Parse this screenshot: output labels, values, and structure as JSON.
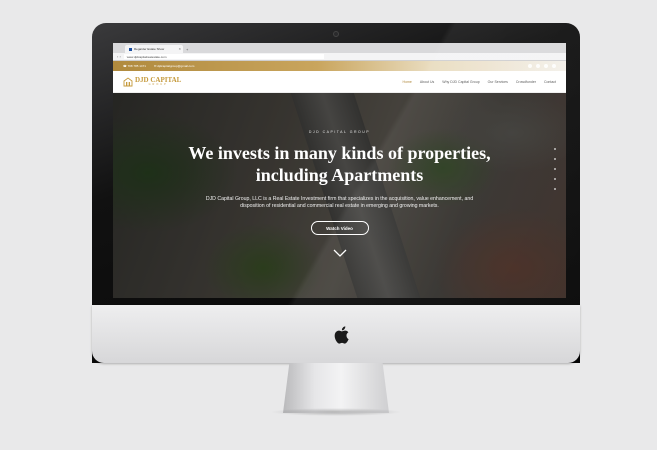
{
  "browser": {
    "tab_title": "Regarder Estate Show",
    "url": "www.djdcapitalreatestate.com"
  },
  "topbar": {
    "phone": "☎ 708 785 1471",
    "email": "✉ djdcapitalgroup@gmail.com"
  },
  "brand": {
    "name": "DJD CAPITAL",
    "sub": "GROUP",
    "color": "#c59a3c"
  },
  "nav": {
    "items": [
      "Home",
      "About Us",
      "Why DJD Capital Group",
      "Our Services",
      "Crowdfunder",
      "Contact"
    ]
  },
  "hero": {
    "kicker": "DJD CAPITAL GROUP",
    "headline": "We invests in many kinds of properties, including Apartments",
    "description": "DJD Capital Group, LLC is a Real Estate Investment firm that specializes in the acquisition, value enhancement, and disposition of residential and commercial real estate in emerging and growing markets.",
    "button_label": "Watch Video"
  },
  "icons": {
    "social": [
      "facebook-icon",
      "twitter-icon",
      "linkedin-icon",
      "instagram-icon"
    ],
    "scroll": "chevron-down-icon",
    "device": "apple-logo"
  }
}
